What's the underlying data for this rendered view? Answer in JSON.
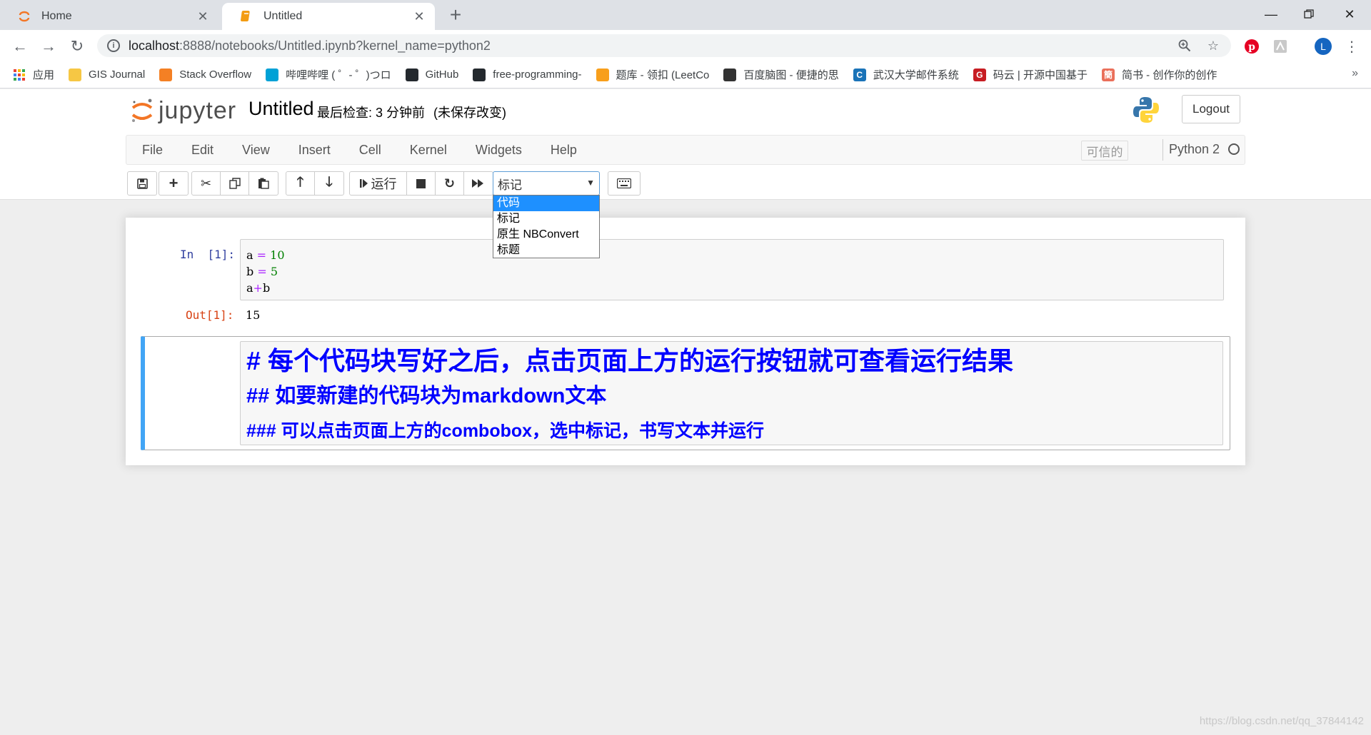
{
  "browser": {
    "tabs": [
      {
        "title": "Home",
        "active": false
      },
      {
        "title": "Untitled",
        "active": true
      }
    ],
    "url_host": "localhost",
    "url_path": ":8888/notebooks/Untitled.ipynb?kernel_name=python2",
    "profile_initial": "L",
    "bookmarks": [
      {
        "label": "应用",
        "color": "#ea4335"
      },
      {
        "label": "GIS Journal",
        "color": "#f6c744"
      },
      {
        "label": "Stack Overflow",
        "color": "#f48024"
      },
      {
        "label": "哔哩哔哩 ( ゜- ゜)つロ",
        "color": "#00a1d6"
      },
      {
        "label": "GitHub",
        "color": "#24292e"
      },
      {
        "label": "free-programming-",
        "color": "#24292e"
      },
      {
        "label": "题库 - 领扣 (LeetCo",
        "color": "#f89f1b"
      },
      {
        "label": "百度脑图 - 便捷的思",
        "color": "#333333"
      },
      {
        "label": "武汉大学邮件系统",
        "color": "#1a73b8"
      },
      {
        "label": "码云 | 开源中国基于",
        "color": "#c71d23"
      },
      {
        "label": "简书 - 创作你的创作",
        "color": "#ea6f5a"
      }
    ],
    "bookmark_icon_text": [
      "",
      "",
      "",
      "",
      "",
      "",
      "",
      "",
      "C",
      "G",
      "簡"
    ]
  },
  "jupyter": {
    "logo_text": "jupyter",
    "notebook_title": "Untitled",
    "checkpoint": "最后检查: 3 分钟前",
    "unsaved": "(未保存改变)",
    "logout": "Logout",
    "menu": [
      "File",
      "Edit",
      "View",
      "Insert",
      "Cell",
      "Kernel",
      "Widgets",
      "Help"
    ],
    "trusted": "可信的",
    "kernel": "Python 2",
    "run_label": "运行",
    "cell_type_selected": "标记",
    "cell_type_options": [
      "代码",
      "标记",
      "原生 NBConvert",
      "标题"
    ],
    "highlighted_option": 0
  },
  "cells": {
    "code": {
      "prompt_in": "In  [1]:",
      "lines": [
        {
          "a": "a",
          "op": "=",
          "b": "10"
        },
        {
          "a": "b",
          "op": "=",
          "b": "5"
        }
      ],
      "line3_a": "a",
      "line3_op": "+",
      "line3_b": "b",
      "prompt_out": "Out[1]:",
      "output": "15"
    },
    "markdown": {
      "h1": "# 每个代码块写好之后，点击页面上方的运行按钮就可查看运行结果",
      "h2": "## 如要新建的代码块为markdown文本",
      "h3": "###  可以点击页面上方的combobox，选中标记，书写文本并运行"
    }
  },
  "watermark": "https://blog.csdn.net/qq_37844142",
  "colors": {
    "accent_blue": "#42a5f5",
    "markdown_text": "#0000ff",
    "prompt_in": "#303f9f",
    "prompt_out": "#d84315",
    "dropdown_highlight": "#1e90ff"
  }
}
